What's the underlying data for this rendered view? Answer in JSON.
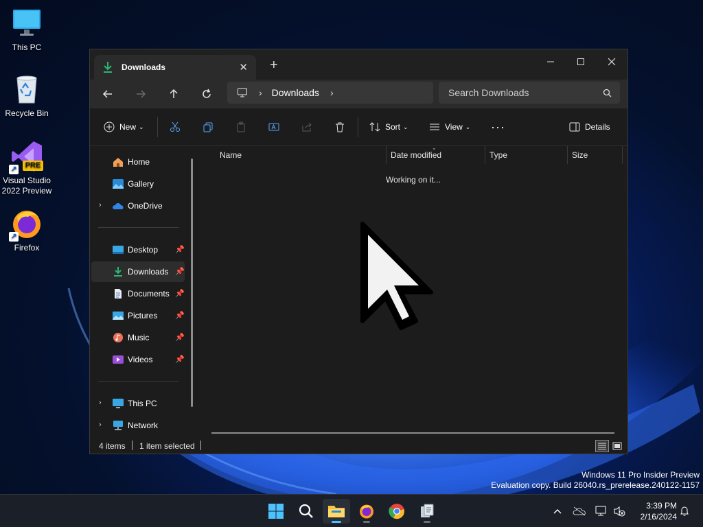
{
  "desktop": {
    "icons": [
      {
        "label": "This PC"
      },
      {
        "label": "Recycle Bin"
      },
      {
        "label": "Visual Studio 2022 Preview",
        "badge": "PRE"
      },
      {
        "label": "Firefox"
      }
    ]
  },
  "window": {
    "tab_title": "Downloads",
    "address_crumb": "Downloads",
    "search_placeholder": "Search Downloads",
    "commands": {
      "new": "New",
      "sort": "Sort",
      "view": "View",
      "details": "Details"
    },
    "sidebar": {
      "home": "Home",
      "gallery": "Gallery",
      "onedrive": "OneDrive",
      "desktop": "Desktop",
      "downloads": "Downloads",
      "documents": "Documents",
      "pictures": "Pictures",
      "music": "Music",
      "videos": "Videos",
      "thispc": "This PC",
      "network": "Network"
    },
    "columns": {
      "name": "Name",
      "date_modified": "Date modified",
      "type": "Type",
      "size": "Size"
    },
    "status_message": "Working on it...",
    "status_items": "4 items",
    "status_selected": "1 item selected"
  },
  "watermark": {
    "line1": "Windows 11 Pro Insider Preview",
    "line2": "Evaluation copy. Build 26040.rs_prerelease.240122-1157"
  },
  "taskbar": {
    "time": "3:39 PM",
    "date": "2/16/2024"
  },
  "colors": {
    "accent": "#4cc2ff",
    "download_green": "#2bb673",
    "folder_yellow": "#f5c542"
  }
}
